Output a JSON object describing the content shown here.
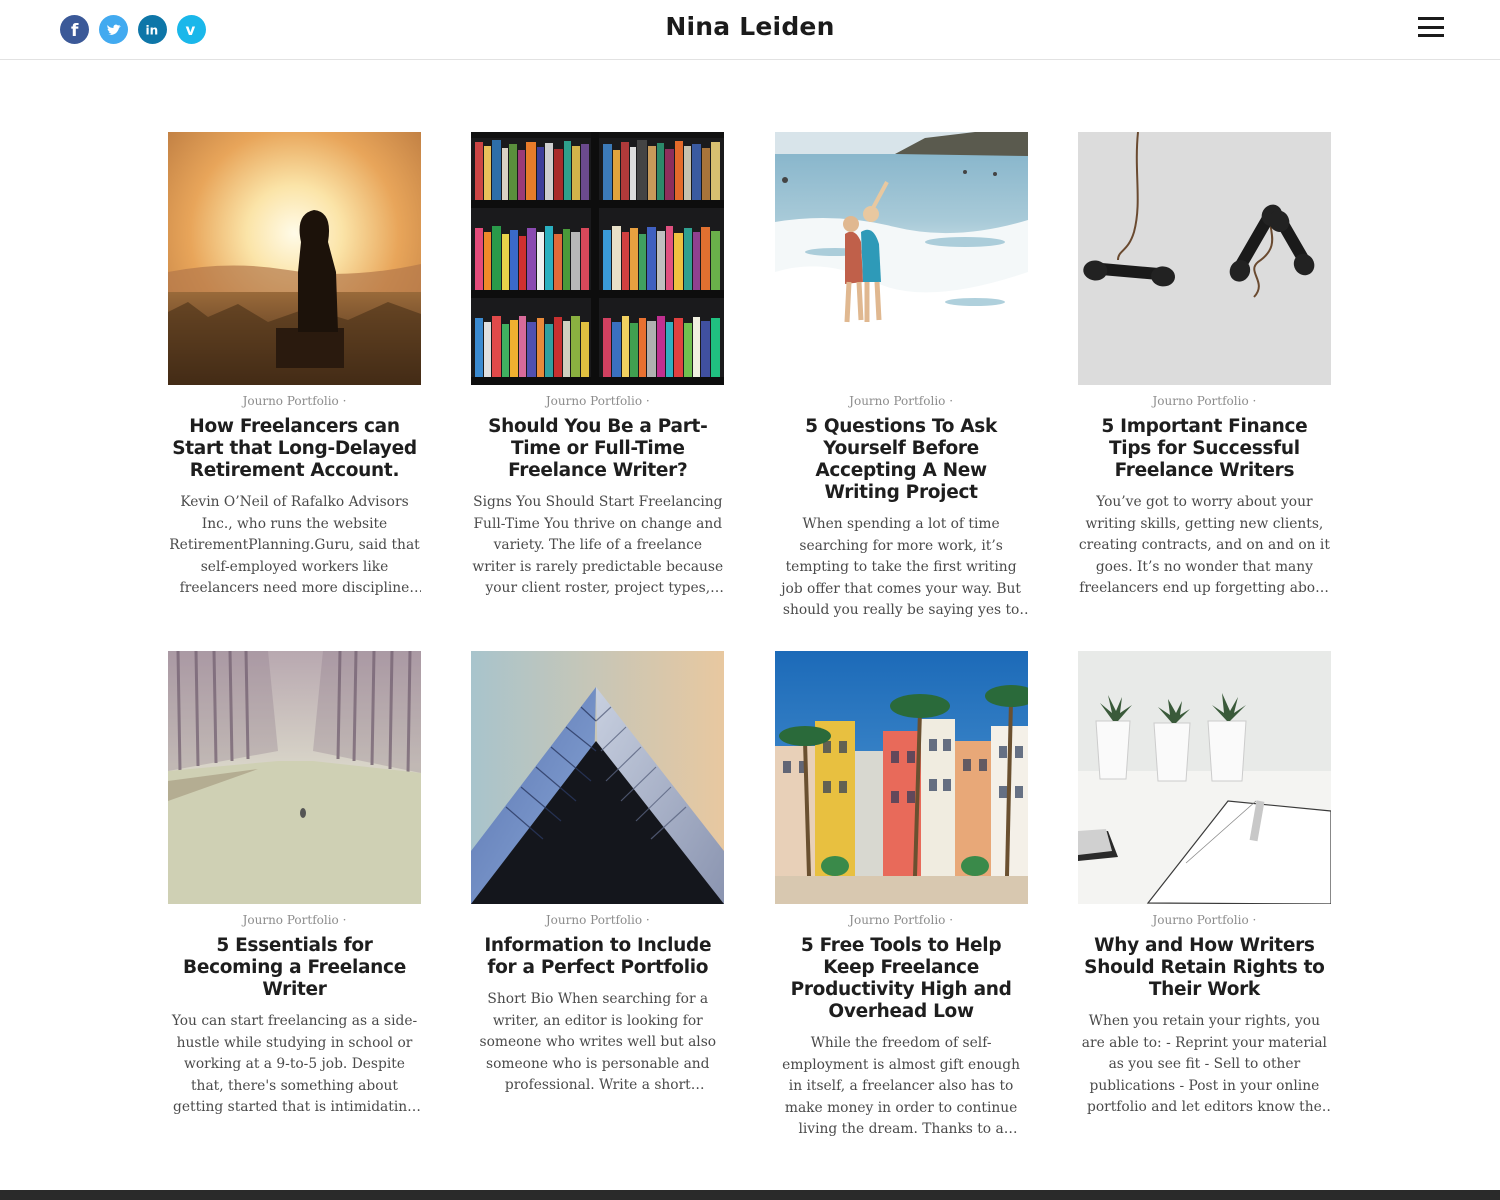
{
  "site": {
    "title": "Nina Leiden"
  },
  "social": [
    {
      "name": "facebook",
      "icon": "facebook-icon",
      "color": "#3b5998"
    },
    {
      "name": "twitter",
      "icon": "twitter-icon",
      "color": "#42aaf0"
    },
    {
      "name": "linkedin",
      "icon": "linkedin-icon",
      "color": "#0e76a8"
    },
    {
      "name": "vimeo",
      "icon": "vimeo-icon",
      "color": "#1ab7ea"
    }
  ],
  "menu": {
    "icon": "hamburger-menu-icon"
  },
  "posts": [
    {
      "category": "Journo Portfolio ·",
      "title": "How Freelancers can Start that Long-Delayed Retirement Account.",
      "excerpt": "Kevin O’Neil of Rafalko Advisors Inc., who runs the website RetirementPlanning.Guru, said that self-employed workers like freelancers need more discipline than employees…",
      "image": "sunset-silhouette-image"
    },
    {
      "category": "Journo Portfolio ·",
      "title": "Should You Be a Part-Time or Full-Time Freelance Writer?",
      "excerpt": "Signs You Should Start Freelancing Full-Time You thrive on change and variety. The life of a freelance writer is rarely predictable because your client roster, project types, and workload ca…",
      "image": "bookshelf-image"
    },
    {
      "category": "Journo Portfolio ·",
      "title": "5 Questions To Ask Yourself Before Accepting A New Writing Project",
      "excerpt": "When spending a lot of time searching for more work, it’s tempting to take the first writing job offer that comes your way. But should you really be saying yes to anything and everything? Befor…",
      "image": "beach-waves-image"
    },
    {
      "category": "Journo Portfolio ·",
      "title": "5 Important Finance Tips for Successful Freelance Writers",
      "excerpt": "You’ve got to worry about your writing skills, getting new clients, creating contracts, and on and on it goes. It’s no wonder that many freelancers end up forgetting about managing their…",
      "image": "telephone-receivers-image"
    },
    {
      "category": "Journo Portfolio ·",
      "title": "5 Essentials for Becoming a Freelance Writer",
      "excerpt": "You can start freelancing as a side-hustle while studying in school or working at a 9-to-5 job. Despite that, there's something about getting started that is intimidating to newbies. If you…",
      "image": "misty-forest-road-image"
    },
    {
      "category": "Journo Portfolio ·",
      "title": "Information to Include for a Perfect Portfolio",
      "excerpt": "Short Bio When searching for a writer, an editor is looking for someone who writes well but also someone who is personable and professional. Write a short biography that explains your…",
      "image": "glass-building-image"
    },
    {
      "category": "Journo Portfolio ·",
      "title": "5 Free Tools to Help Keep Freelance Productivity High and Overhead Low",
      "excerpt": "While the freedom of self-employment is almost gift enough in itself, a freelancer also has to make money in order to continue living the dream. Thanks to a plethora of apps and…",
      "image": "colorful-houses-palms-image"
    },
    {
      "category": "Journo Portfolio ·",
      "title": "Why and How Writers Should Retain Rights to Their Work",
      "excerpt": "When you retain your rights, you are able to: - Reprint your material as you see fit - Sell to other publications - Post in your online portfolio and let editors know the piece is available for…",
      "image": "plants-notebook-image"
    }
  ]
}
